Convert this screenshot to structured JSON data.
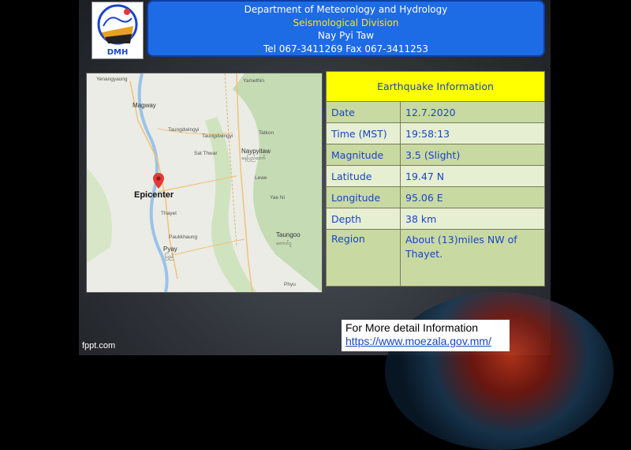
{
  "header": {
    "line1": "Department of Meteorology and Hydrology",
    "line2": "Seismological Division",
    "line3": "Nay Pyi Taw",
    "line4": "Tel 067-3411269 Fax 067-3411253",
    "logo_text": "DMH"
  },
  "map": {
    "epicenter_label": "Epicenter",
    "places": {
      "yenangyaung": "Yenangyaung",
      "yamethin": "Yamethin",
      "magway": "Magway",
      "taungdwingyi": "Taungdwingyi",
      "taungdwingyi2": "Taungdwingyi",
      "tatkon": "Tatkon",
      "sat_thwar": "Sat Thwar",
      "naypyitaw": "Naypyitaw",
      "naypyitaw_mm": "နေပြည်တော်",
      "lewe": "Lewe",
      "yae_ni": "Yae Ni",
      "thayet": "Thayet",
      "paukkhaung": "Paukkhaung",
      "taungoo": "Taungoo",
      "pyay": "Pyay",
      "pyay_mm": "ပြည်",
      "phyu": "Phyu",
      "taungoo_mm": "တောင်ငူ"
    }
  },
  "info": {
    "title": "Earthquake Information",
    "rows": [
      {
        "label": "Date",
        "value": "12.7.2020"
      },
      {
        "label": "Time (MST)",
        "value": "19:58:13"
      },
      {
        "label": "Magnitude",
        "value": "3.5 (Slight)"
      },
      {
        "label": "Latitude",
        "value": "19.47 N"
      },
      {
        "label": "Longitude",
        "value": "95.06 E"
      },
      {
        "label": "Depth",
        "value": "38 km"
      },
      {
        "label": "Region",
        "value": "About (13)miles NW of Thayet."
      }
    ]
  },
  "more_info": {
    "line1": "For More detail Information",
    "line2": "https://www.moezala.gov.mm/"
  },
  "footer": {
    "credit": "fppt.com"
  },
  "colors": {
    "banner": "#1e6be6",
    "title_bg": "#ffff00",
    "row_a": "#c9d9a2",
    "row_b": "#e6efd2",
    "text_blue": "#1a44c9",
    "epicenter_pin": "#e53935"
  }
}
